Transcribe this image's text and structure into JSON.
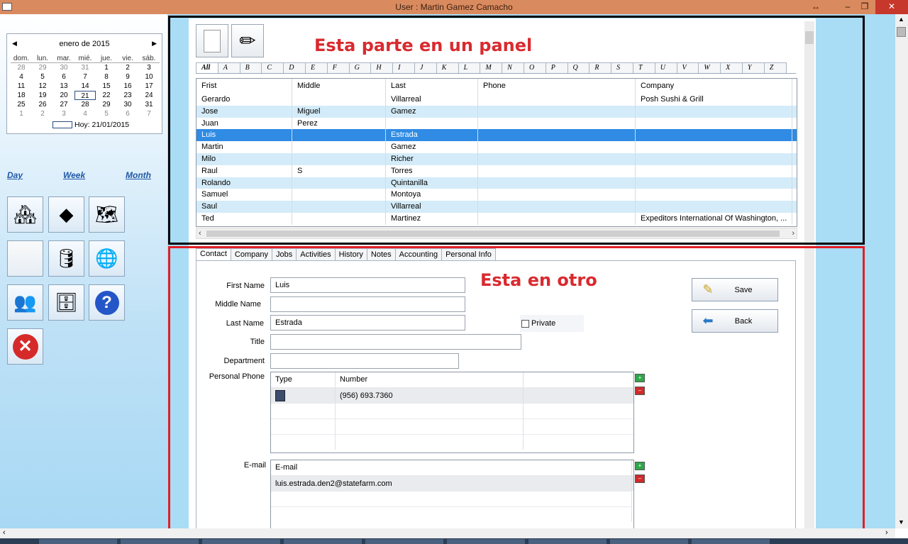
{
  "window": {
    "title": "User : Martin Gamez Camacho"
  },
  "calendar": {
    "month": "enero de 2015",
    "days_of_week": [
      "dom.",
      "lun.",
      "mar.",
      "mié.",
      "jue.",
      "vie.",
      "sáb."
    ],
    "weeks": [
      [
        "28",
        "29",
        "30",
        "31",
        "1",
        "2",
        "3"
      ],
      [
        "4",
        "5",
        "6",
        "7",
        "8",
        "9",
        "10"
      ],
      [
        "11",
        "12",
        "13",
        "14",
        "15",
        "16",
        "17"
      ],
      [
        "18",
        "19",
        "20",
        "21",
        "22",
        "23",
        "24"
      ],
      [
        "25",
        "26",
        "27",
        "28",
        "29",
        "30",
        "31"
      ],
      [
        "1",
        "2",
        "3",
        "4",
        "5",
        "6",
        "7"
      ]
    ],
    "today_label": "Hoy: 21/01/2015"
  },
  "views": {
    "day": "Day",
    "week": "Week",
    "month": "Month"
  },
  "annotations": {
    "top": "Esta parte en un panel",
    "bottom": "Esta en otro"
  },
  "alphabet": [
    "All",
    "A",
    "B",
    "C",
    "D",
    "E",
    "F",
    "G",
    "H",
    "I",
    "J",
    "K",
    "L",
    "M",
    "N",
    "O",
    "P",
    "Q",
    "R",
    "S",
    "T",
    "U",
    "V",
    "W",
    "X",
    "Y",
    "Z"
  ],
  "contacts": {
    "columns": [
      "Frist",
      "Middle",
      "Last",
      "Phone",
      "Company"
    ],
    "rows": [
      [
        "Gerardo",
        "",
        "Villarreal",
        "",
        "Posh Sushi & Grill"
      ],
      [
        "Jose",
        "Miguel",
        "Gamez",
        "",
        ""
      ],
      [
        "Juan",
        "Perez",
        "",
        "",
        ""
      ],
      [
        "Luis",
        "",
        "Estrada",
        "",
        ""
      ],
      [
        "Martin",
        "",
        "Gamez",
        "",
        ""
      ],
      [
        "Milo",
        "",
        "Richer",
        "",
        ""
      ],
      [
        "Raul",
        "S",
        "Torres",
        "",
        ""
      ],
      [
        "Rolando",
        "",
        "Quintanilla",
        "",
        ""
      ],
      [
        "Samuel",
        "",
        "Montoya",
        "",
        ""
      ],
      [
        "Saul",
        "",
        "Villarreal",
        "",
        ""
      ],
      [
        "Ted",
        "",
        "Martinez",
        "",
        "Expeditors International Of Washington, ..."
      ]
    ],
    "selected_row": 3
  },
  "tabs": [
    "Contact",
    "Company",
    "Jobs",
    "Activities",
    "History",
    "Notes",
    "Accounting",
    "Personal Info"
  ],
  "form": {
    "first_name_label": "First Name",
    "first_name": "Luis",
    "middle_name_label": "Middle Name",
    "middle_name": "",
    "last_name_label": "Last Name",
    "last_name": "Estrada",
    "title_label": "Title",
    "title": "",
    "department_label": "Department",
    "department": "",
    "private_label": "Private",
    "personal_phone_label": "Personal Phone",
    "email_label": "E-mail"
  },
  "buttons": {
    "save": "Save",
    "back": "Back"
  },
  "phones": {
    "columns": [
      "Type",
      "Number",
      ""
    ],
    "rows": [
      [
        "",
        "(956) 693.7360",
        ""
      ]
    ]
  },
  "emails": {
    "column": "E-mail",
    "rows": [
      "luis.estrada.den2@statefarm.com"
    ]
  },
  "colors": {
    "annotation": "#d92a2f",
    "top_panel_border": "#000000",
    "bottom_panel_border": "#e21f26",
    "selection": "#2f8be4",
    "alt_row": "#d4ecf9"
  }
}
